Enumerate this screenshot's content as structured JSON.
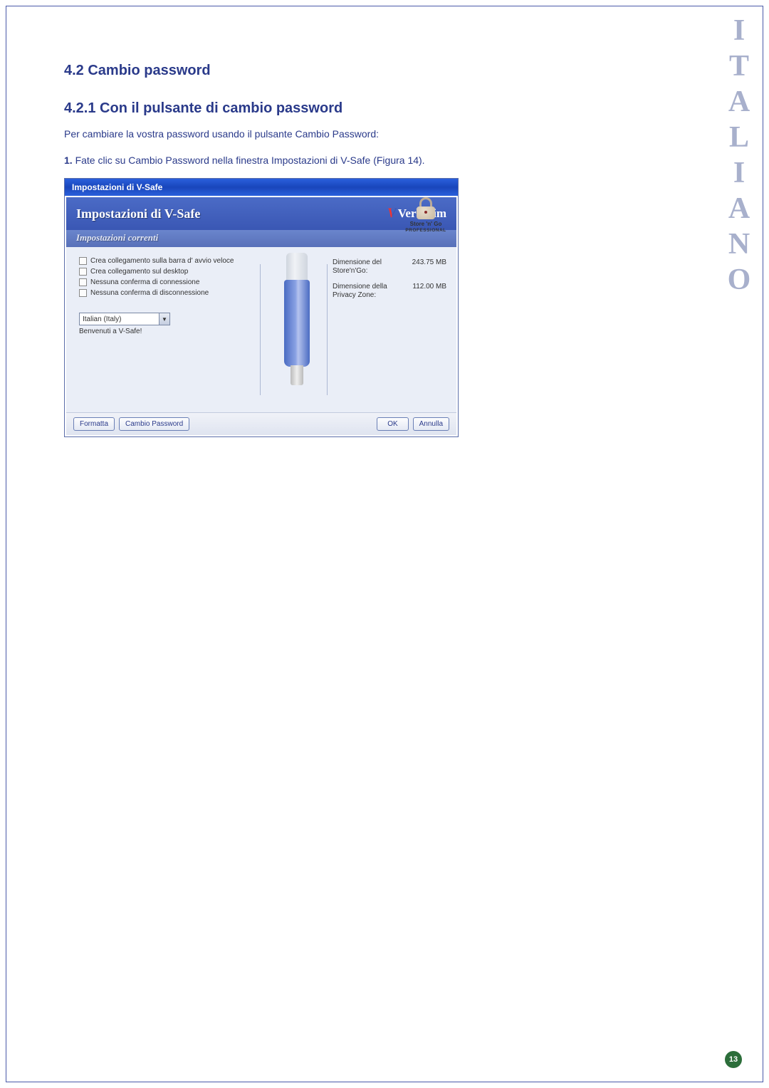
{
  "sidebar_language": "ITALIANO",
  "page_number": "13",
  "headings": {
    "h2": "4.2 Cambio password",
    "h3": "4.2.1 Con il pulsante di cambio password"
  },
  "paragraph": "Per cambiare la vostra password usando il pulsante Cambio Password:",
  "step": {
    "num": "1.",
    "text": " Fate clic su Cambio Password nella finestra Impostazioni di V-Safe (Figura 14)."
  },
  "dialog": {
    "titlebar": "Impostazioni di V-Safe",
    "header_title": "Impostazioni di V-Safe",
    "logo_text": "Verbatim",
    "subheader": "Impostazioni correnti",
    "checkboxes": [
      "Crea collegamento sulla barra d' avvio veloce",
      "Crea collegamento sul desktop",
      "Nessuna conferma di connessione",
      "Nessuna conferma di disconnessione"
    ],
    "language_selected": "Italian (Italy)",
    "welcome": "Benvenuti a V-Safe!",
    "brand_label": "Store 'n' Go",
    "brand_sub": "PROFESSIONAL",
    "info": {
      "size_label": "Dimensione del Store'n'Go:",
      "size_value": "243.75 MB",
      "zone_label": "Dimensione della Privacy Zone:",
      "zone_value": "112.00 MB"
    },
    "buttons": {
      "format": "Formatta",
      "change_pw": "Cambio Password",
      "ok": "OK",
      "cancel": "Annulla"
    }
  }
}
